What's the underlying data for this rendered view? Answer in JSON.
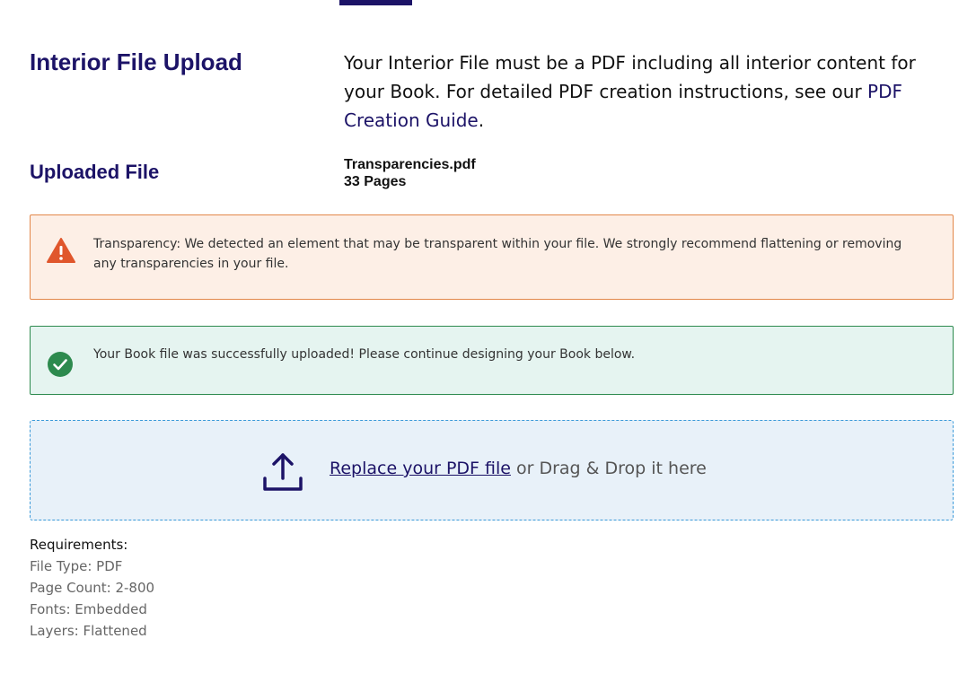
{
  "header": {
    "title": "Interior File Upload",
    "intro_text": "Your Interior File must be a PDF including all interior content for your Book. For detailed PDF creation instructions, see our ",
    "guide_link": "PDF Creation Guide",
    "intro_end": "."
  },
  "uploaded": {
    "title": "Uploaded File",
    "file_name": "Transparencies.pdf",
    "page_count": "33 Pages"
  },
  "alerts": {
    "warning": {
      "icon": "warning-triangle-icon",
      "color": "#e0562c",
      "text": "Transparency: We detected an element that may be transparent within your file. We strongly recommend flattening or removing any transparencies in your file."
    },
    "success": {
      "icon": "check-circle-icon",
      "color": "#2d8a4e",
      "text": "Your Book file was successfully uploaded! Please continue designing your Book below."
    }
  },
  "dropzone": {
    "icon": "upload-icon",
    "link_label": "Replace your PDF file",
    "suffix": " or Drag & Drop it here"
  },
  "requirements": {
    "heading": "Requirements:",
    "items": [
      "File Type: PDF",
      "Page Count: 2-800",
      "Fonts: Embedded",
      "Layers: Flattened"
    ]
  },
  "colors": {
    "brand": "#1c1367",
    "dropzone_border": "#3b9ad9"
  }
}
